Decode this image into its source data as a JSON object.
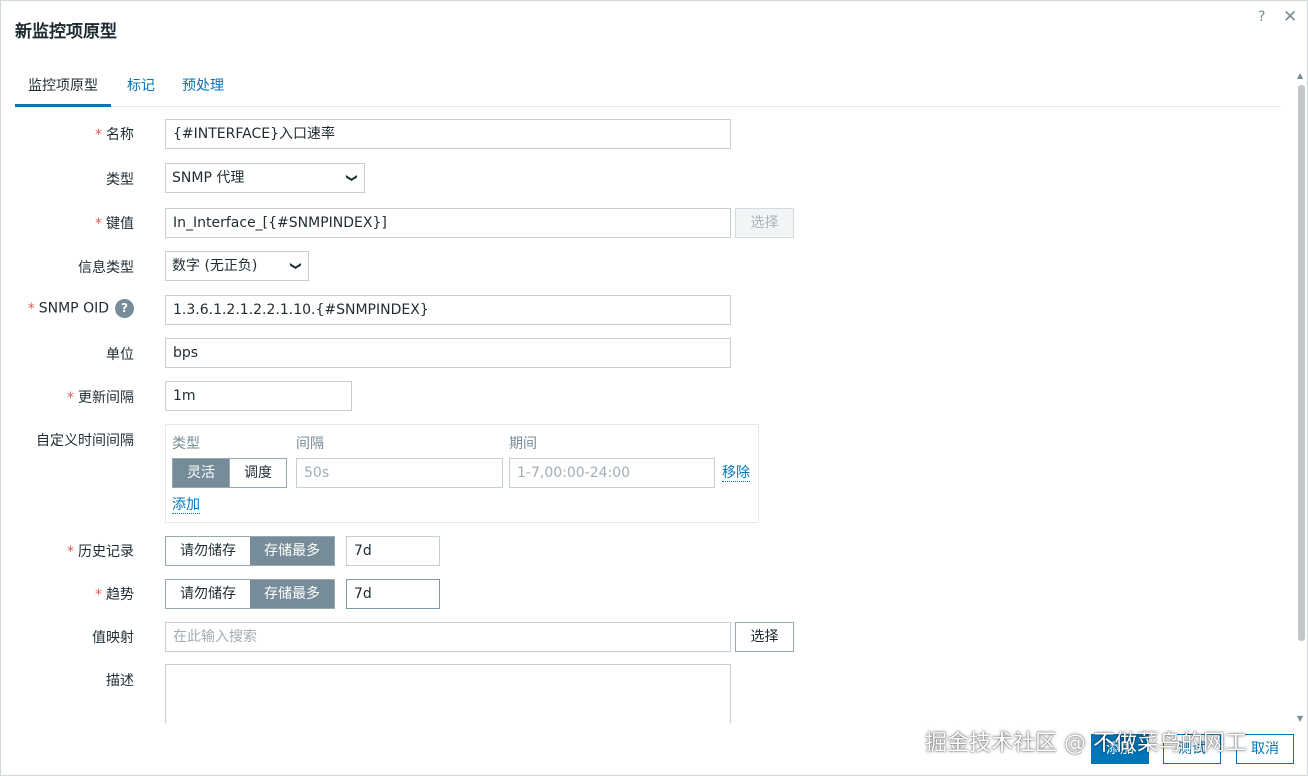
{
  "dialog": {
    "title": "新监控项原型",
    "help_glyph": "?",
    "close_glyph": "✕"
  },
  "tabs": [
    {
      "label": "监控项原型"
    },
    {
      "label": "标记"
    },
    {
      "label": "预处理"
    }
  ],
  "form": {
    "name": {
      "label": "名称",
      "value": "{#INTERFACE}入口速率"
    },
    "type": {
      "label": "类型",
      "value": "SNMP 代理"
    },
    "key": {
      "label": "键值",
      "value": "In_Interface_[{#SNMPINDEX}]",
      "button": "选择"
    },
    "info_type": {
      "label": "信息类型",
      "value": "数字 (无正负)"
    },
    "snmp_oid": {
      "label": "SNMP OID",
      "help": "?",
      "value": "1.3.6.1.2.1.2.2.1.10.{#SNMPINDEX}"
    },
    "units": {
      "label": "单位",
      "value": "bps"
    },
    "interval": {
      "label": "更新间隔",
      "value": "1m"
    },
    "custom_intervals": {
      "label": "自定义时间间隔",
      "col_type": "类型",
      "col_interval": "间隔",
      "col_period": "期间",
      "toggle": [
        "灵活",
        "调度"
      ],
      "interval_placeholder": "50s",
      "period_placeholder": "1-7,00:00-24:00",
      "remove": "移除",
      "add": "添加"
    },
    "history": {
      "label": "历史记录",
      "options": [
        "请勿储存",
        "存储最多"
      ],
      "value": "7d"
    },
    "trends": {
      "label": "趋势",
      "options": [
        "请勿储存",
        "存储最多"
      ],
      "value": "7d"
    },
    "valuemap": {
      "label": "值映射",
      "placeholder": "在此输入搜索",
      "button": "选择"
    },
    "description": {
      "label": "描述"
    }
  },
  "footer": {
    "add": "添加",
    "test": "测试",
    "cancel": "取消"
  },
  "watermark": "掘金技术社区 @ 不做菜鸟的网工",
  "colors": {
    "accent": "#0275b8",
    "required": "#e45959",
    "toggle_on": "#768d99"
  }
}
